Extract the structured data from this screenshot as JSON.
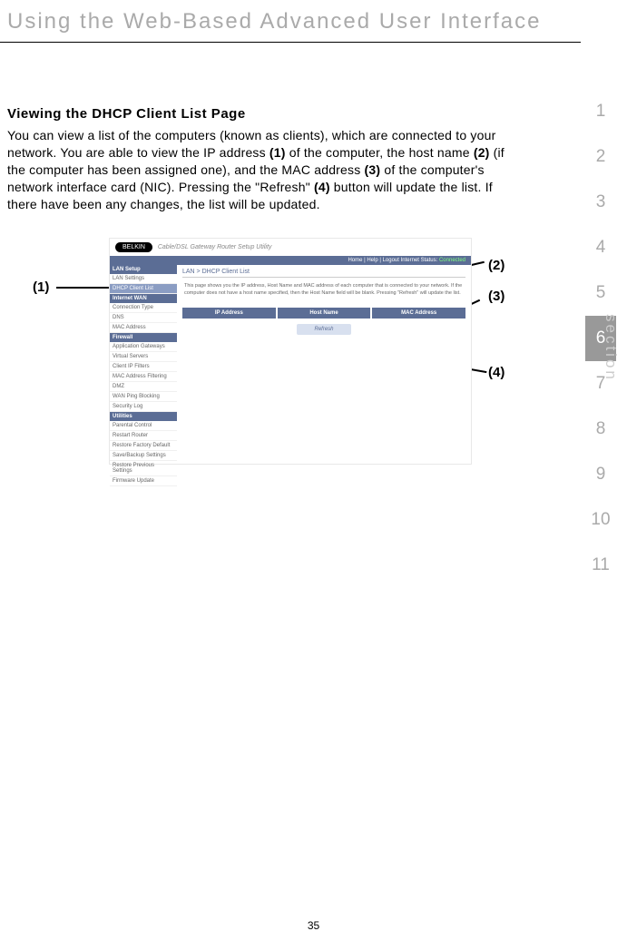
{
  "header": {
    "title": "Using the Web-Based Advanced User Interface"
  },
  "sectionNav": {
    "label": "section",
    "items": [
      "1",
      "2",
      "3",
      "4",
      "5",
      "6",
      "7",
      "8",
      "9",
      "10",
      "11"
    ],
    "activeIndex": 5
  },
  "content": {
    "heading": "Viewing the DHCP Client List Page",
    "body_pre": "You can view a list of the computers (known as clients), which are connected to your network. You are able to view the IP address ",
    "b1": "(1)",
    "body_p1": " of the computer, the host name ",
    "b2": "(2)",
    "body_p2": " (if the computer has been assigned one), and the MAC address ",
    "b3": "(3)",
    "body_p3": " of the computer's network interface card (NIC). Pressing the \"Refresh\" ",
    "b4": "(4)",
    "body_p4": " button will update the list. If there have been any changes, the list will be updated."
  },
  "callouts": {
    "c1": "(1)",
    "c2": "(2)",
    "c3": "(3)",
    "c4": "(4)"
  },
  "screenshot": {
    "logo": "BELKIN",
    "tagline": "Cable/DSL Gateway Router Setup Utility",
    "topnav": "Home | Help | Logout    Internet Status: ",
    "status": "Connected",
    "sidebar": {
      "groups": [
        {
          "header": "LAN Setup",
          "items": [
            "LAN Settings",
            "DHCP Client List"
          ]
        },
        {
          "header": "Internet WAN",
          "items": [
            "Connection Type",
            "DNS",
            "MAC Address"
          ]
        },
        {
          "header": "Firewall",
          "items": [
            "Application Gateways",
            "Virtual Servers",
            "Client IP Filters",
            "MAC Address Filtering",
            "DMZ",
            "WAN Ping Blocking",
            "Security Log"
          ]
        },
        {
          "header": "Utilities",
          "items": [
            "Parental Control",
            "Restart Router",
            "Restore Factory Default",
            "Save/Backup Settings",
            "Restore Previous Settings",
            "Firmware Update"
          ]
        }
      ],
      "activeItem": "DHCP Client List"
    },
    "breadcrumb": "LAN > DHCP Client List",
    "description": "This page shows you the IP address, Host Name and MAC address of each computer that is connected to your network. If the computer does not have a host name specified, then the Host Name field will be blank. Pressing \"Refresh\" will update the list.",
    "table": {
      "col1": "IP Address",
      "col2": "Host Name",
      "col3": "MAC Address"
    },
    "refresh": "Refresh"
  },
  "pageNumber": "35"
}
